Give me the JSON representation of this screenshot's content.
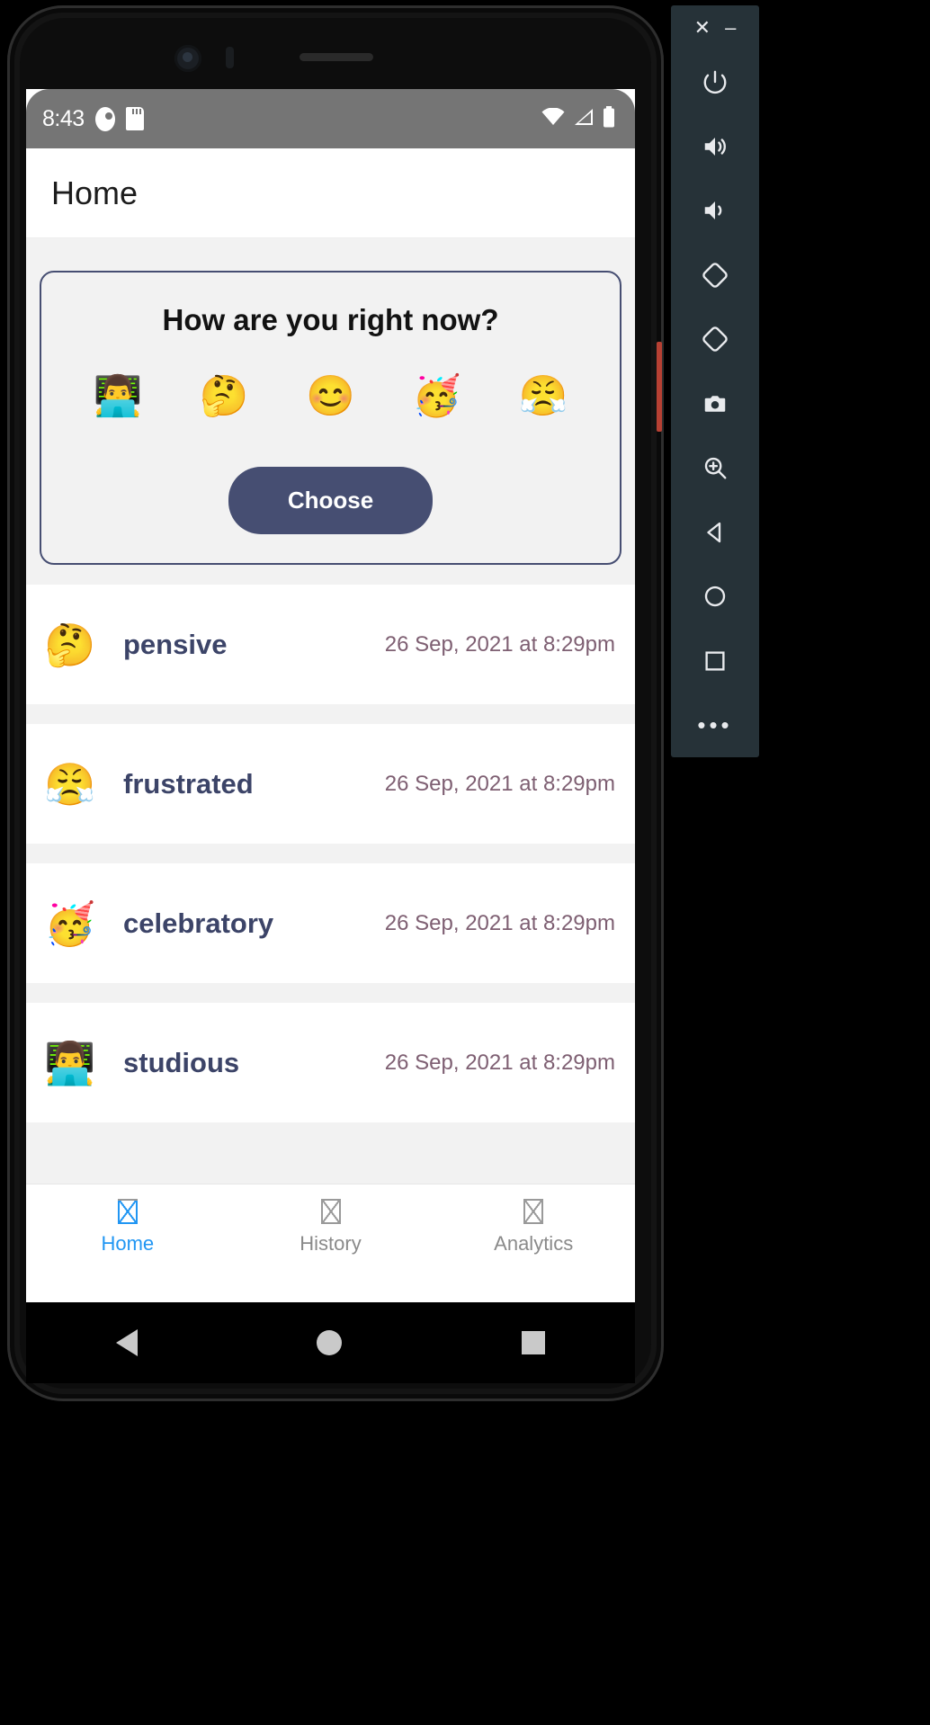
{
  "status_bar": {
    "time": "8:43",
    "left_icons": [
      "do-not-disturb-icon",
      "sd-card-icon"
    ],
    "right_icons": [
      "wifi-icon",
      "cellular-signal-icon",
      "battery-icon"
    ]
  },
  "app_bar": {
    "title": "Home"
  },
  "mood_card": {
    "question": "How are you right now?",
    "emojis": [
      {
        "glyph": "👨‍💻",
        "name": "technologist-emoji",
        "mood": "studious"
      },
      {
        "glyph": "🤔",
        "name": "thinking-face-emoji",
        "mood": "pensive"
      },
      {
        "glyph": "😊",
        "name": "smiling-face-emoji",
        "mood": "happy"
      },
      {
        "glyph": "🥳",
        "name": "partying-face-emoji",
        "mood": "celebratory"
      },
      {
        "glyph": "😤",
        "name": "face-with-steam-emoji",
        "mood": "frustrated"
      }
    ],
    "choose_label": "Choose"
  },
  "history": {
    "rows": [
      {
        "emoji": "🤔",
        "icon_name": "thinking-face-emoji",
        "label": "pensive",
        "date": "26 Sep, 2021 at 8:29pm"
      },
      {
        "emoji": "😤",
        "icon_name": "face-with-steam-emoji",
        "label": "frustrated",
        "date": "26 Sep, 2021 at 8:29pm"
      },
      {
        "emoji": "🥳",
        "icon_name": "partying-face-emoji",
        "label": "celebratory",
        "date": "26 Sep, 2021 at 8:29pm"
      },
      {
        "emoji": "👨‍💻",
        "icon_name": "technologist-emoji",
        "label": "studious",
        "date": "26 Sep, 2021 at 8:29pm"
      }
    ]
  },
  "bottom_nav": {
    "items": [
      {
        "label": "Home",
        "active": true
      },
      {
        "label": "History",
        "active": false
      },
      {
        "label": "Analytics",
        "active": false
      }
    ]
  },
  "system_nav": {
    "buttons": [
      "back-button",
      "home-button",
      "recents-button"
    ]
  },
  "emulator_toolbar": {
    "window_buttons": [
      "close-button",
      "minimize-button"
    ],
    "close_glyph": "✕",
    "minimize_glyph": "–",
    "more_glyph": "•••",
    "buttons": [
      "power-button",
      "volume-up-button",
      "volume-down-button",
      "rotate-left-button",
      "rotate-right-button",
      "screenshot-button",
      "zoom-button",
      "back-button",
      "home-button",
      "overview-button",
      "more-button"
    ]
  },
  "colors": {
    "accent": "#464e72",
    "nav_active": "#2196f3",
    "row_label": "#3c4468",
    "row_date": "#7e5f72",
    "status_bar_bg": "#757575",
    "toolbar_bg": "#263238"
  }
}
